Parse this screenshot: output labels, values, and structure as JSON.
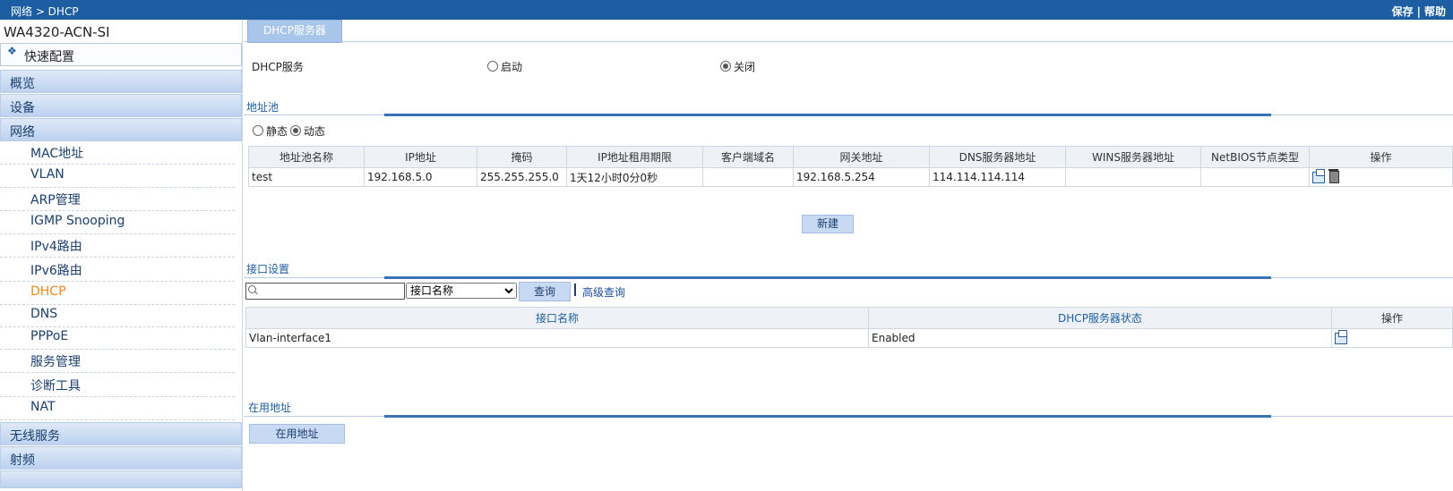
{
  "topbar": {
    "breadcrumb": "网络 > DHCP",
    "save": "保存",
    "help": "帮助"
  },
  "sidebar": {
    "device": "WA4320-ACN-SI",
    "quick_config": "快速配置",
    "sections_top": [
      "概览",
      "设备",
      "网络"
    ],
    "network_items": [
      "MAC地址",
      "VLAN",
      "ARP管理",
      "IGMP Snooping",
      "IPv4路由",
      "IPv6路由",
      "DHCP",
      "DNS",
      "PPPoE",
      "服务管理",
      "诊断工具",
      "NAT"
    ],
    "active_item": "DHCP",
    "sections_bottom": [
      "无线服务",
      "射频"
    ]
  },
  "main": {
    "tab": "DHCP服务器",
    "dhcp_service": {
      "label": "DHCP服务",
      "on": "启动",
      "off": "关闭",
      "selected": "关闭"
    },
    "pool": {
      "title": "地址池",
      "mode_static": "静态",
      "mode_dynamic": "动态",
      "mode_selected": "动态",
      "columns": [
        "地址池名称",
        "IP地址",
        "掩码",
        "IP地址租用期限",
        "客户端域名",
        "网关地址",
        "DNS服务器地址",
        "WINS服务器地址",
        "NetBIOS节点类型",
        "操作"
      ],
      "rows": [
        [
          "test",
          "192.168.5.0",
          "255.255.255.0",
          "1天12小时0分0秒",
          "",
          "192.168.5.254",
          "114.114.114.114",
          "",
          ""
        ]
      ],
      "new_button": "新建"
    },
    "iface": {
      "title": "接口设置",
      "search_placeholder": "",
      "filter_selected": "接口名称",
      "query_button": "查询",
      "advanced": "高级查询",
      "columns": [
        "接口名称",
        "DHCP服务器状态",
        "操作"
      ],
      "rows": [
        [
          "Vlan-interface1",
          "Enabled"
        ]
      ]
    },
    "inuse": {
      "title": "在用地址",
      "button": "在用地址"
    }
  }
}
